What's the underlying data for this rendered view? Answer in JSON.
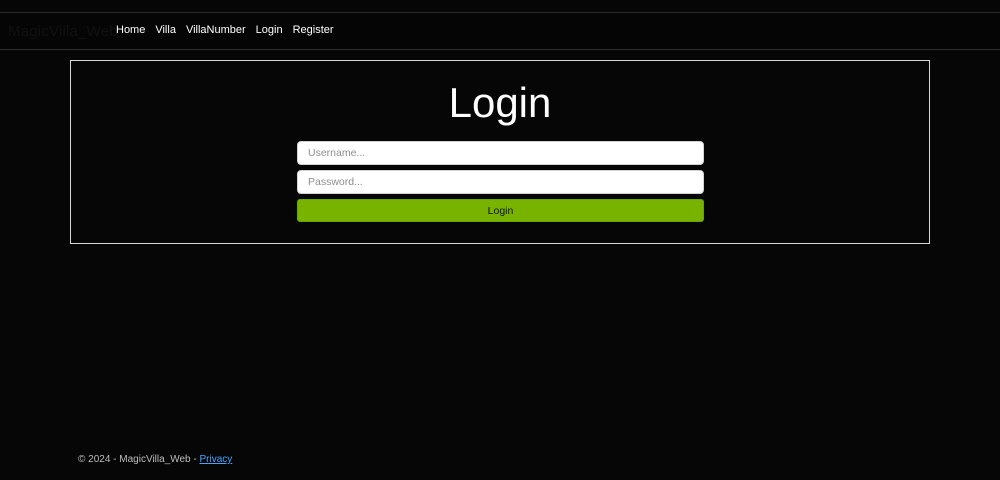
{
  "navbar": {
    "brand": "MagicVilla_Web",
    "links": [
      "Home",
      "Villa",
      "VillaNumber",
      "Login",
      "Register"
    ]
  },
  "login": {
    "title": "Login",
    "username_placeholder": "Username...",
    "password_placeholder": "Password...",
    "submit_label": "Login"
  },
  "footer": {
    "text": "© 2024 - MagicVilla_Web - ",
    "privacy_link": "Privacy"
  },
  "colors": {
    "background": "#060606",
    "accent": "#78b300",
    "link": "#4ba3ff"
  }
}
